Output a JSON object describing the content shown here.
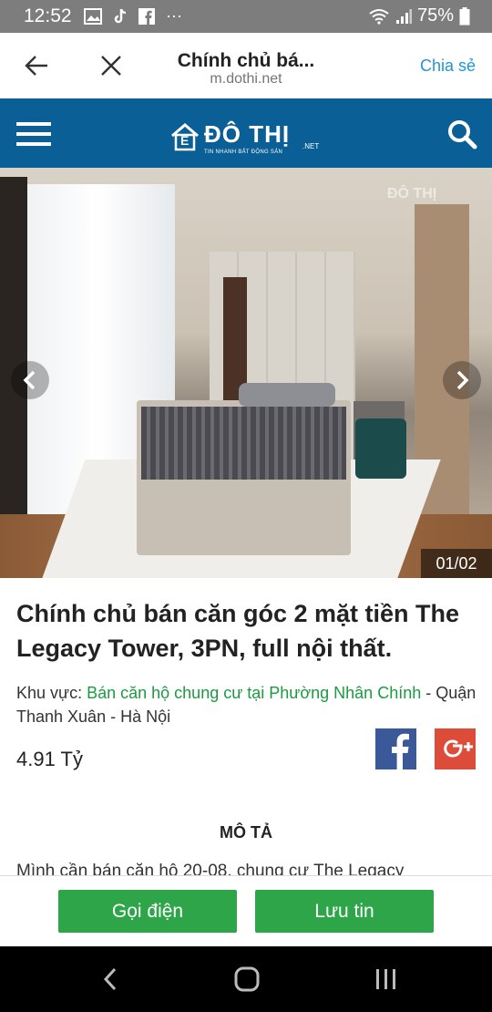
{
  "status_bar": {
    "time": "12:52",
    "dots": "···",
    "battery_text": "75%"
  },
  "browser": {
    "title": "Chính chủ bá...",
    "url": "m.dothi.net",
    "share_label": "Chia sẻ"
  },
  "site": {
    "brand": "ĐÔ THỊ",
    "tagline": "TIN NHANH BẤT ĐỘNG SẢN",
    "net": ".NET",
    "logo_letter": "E"
  },
  "gallery": {
    "counter": "01/02",
    "watermark": "ĐÔ THỊ"
  },
  "listing": {
    "title": "Chính chủ bán căn góc 2 mặt tiền The Legacy Tower, 3PN, full nội thất.",
    "area_label": "Khu vực: ",
    "area_link": "Bán căn hộ chung cư tại Phường Nhân Chính",
    "area_rest": " - Quận Thanh Xuân - Hà Nội",
    "price": "4.91 Tỷ",
    "section_title": "MÔ TẢ",
    "description": "Mình cần bán căn hộ 20-08, chung cư The Legacy"
  },
  "social": {
    "facebook": "f",
    "google": "G+"
  },
  "actions": {
    "call": "Gọi điện",
    "save": "Lưu tin"
  },
  "colors": {
    "header": "#0a5f96",
    "accent": "#2196d3",
    "green": "#2ea548",
    "link": "#1c9a41"
  }
}
